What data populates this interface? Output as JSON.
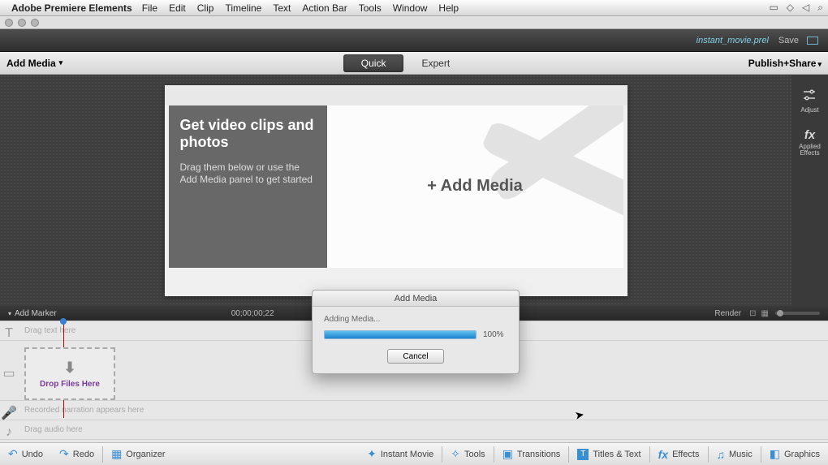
{
  "menubar": {
    "app_name": "Adobe Premiere Elements",
    "items": [
      "File",
      "Edit",
      "Clip",
      "Timeline",
      "Text",
      "Action Bar",
      "Tools",
      "Window",
      "Help"
    ]
  },
  "appchrome": {
    "project_name": "instant_movie.prel",
    "save_label": "Save"
  },
  "toolbar": {
    "add_media_label": "Add Media",
    "tab_quick": "Quick",
    "tab_expert": "Expert",
    "publish_label": "Publish+Share"
  },
  "sidebar": {
    "adjust": "Adjust",
    "effects": "Applied Effects"
  },
  "preview": {
    "heading": "Get video clips and photos",
    "sub": "Drag them below or use the Add Media panel to get started",
    "add_label": "+  Add Media"
  },
  "timeline": {
    "add_marker": "Add Marker",
    "timecode": "00;00;00;22",
    "render": "Render",
    "track_text_hint": "Drag text here",
    "track_narration_hint": "Recorded narration appears here",
    "track_audio_hint": "Drag audio here",
    "drop_label": "Drop Files Here"
  },
  "actionbar": {
    "undo": "Undo",
    "redo": "Redo",
    "organizer": "Organizer",
    "instant_movie": "Instant Movie",
    "tools": "Tools",
    "transitions": "Transitions",
    "titles": "Titles & Text",
    "effects": "Effects",
    "music": "Music",
    "graphics": "Graphics"
  },
  "modal": {
    "title": "Add Media",
    "status": "Adding Media...",
    "percent_label": "100%",
    "percent_value": 100,
    "cancel": "Cancel"
  }
}
